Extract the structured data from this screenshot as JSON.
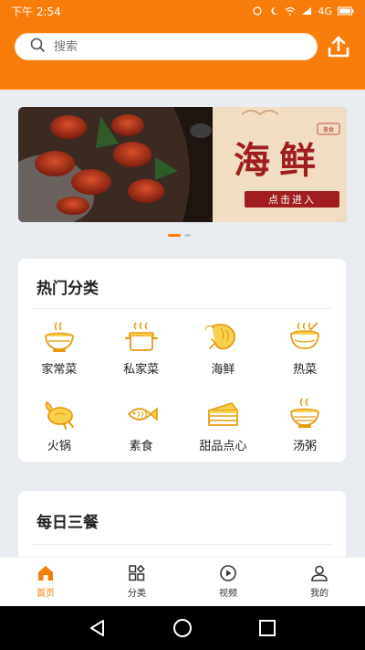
{
  "statusbar": {
    "time": "下午 2:54",
    "network": "4G"
  },
  "search": {
    "placeholder": "搜索"
  },
  "colors": {
    "brand": "#f87d0a",
    "icon_stroke": "#e89b10",
    "icon_fill": "#f8d24e",
    "banner_red": "#a01e1e"
  },
  "banner": {
    "title": "海鲜",
    "button": "点击进入",
    "stamp": "美食"
  },
  "categories_card": {
    "title": "热门分类",
    "items": [
      {
        "label": "家常菜",
        "icon": "noodle-bowl-icon"
      },
      {
        "label": "私家菜",
        "icon": "cooking-pot-icon"
      },
      {
        "label": "海鲜",
        "icon": "shrimp-icon"
      },
      {
        "label": "热菜",
        "icon": "hot-bowl-icon"
      },
      {
        "label": "火锅",
        "icon": "roast-chicken-icon"
      },
      {
        "label": "素食",
        "icon": "fish-icon"
      },
      {
        "label": "甜品点心",
        "icon": "cake-icon"
      },
      {
        "label": "汤粥",
        "icon": "soup-bowl-icon"
      }
    ]
  },
  "meals_card": {
    "title": "每日三餐"
  },
  "tabbar": {
    "tabs": [
      {
        "label": "首页",
        "icon": "home-icon",
        "active": true
      },
      {
        "label": "分类",
        "icon": "grid-icon",
        "active": false
      },
      {
        "label": "视频",
        "icon": "play-icon",
        "active": false
      },
      {
        "label": "我的",
        "icon": "user-icon",
        "active": false
      }
    ]
  }
}
